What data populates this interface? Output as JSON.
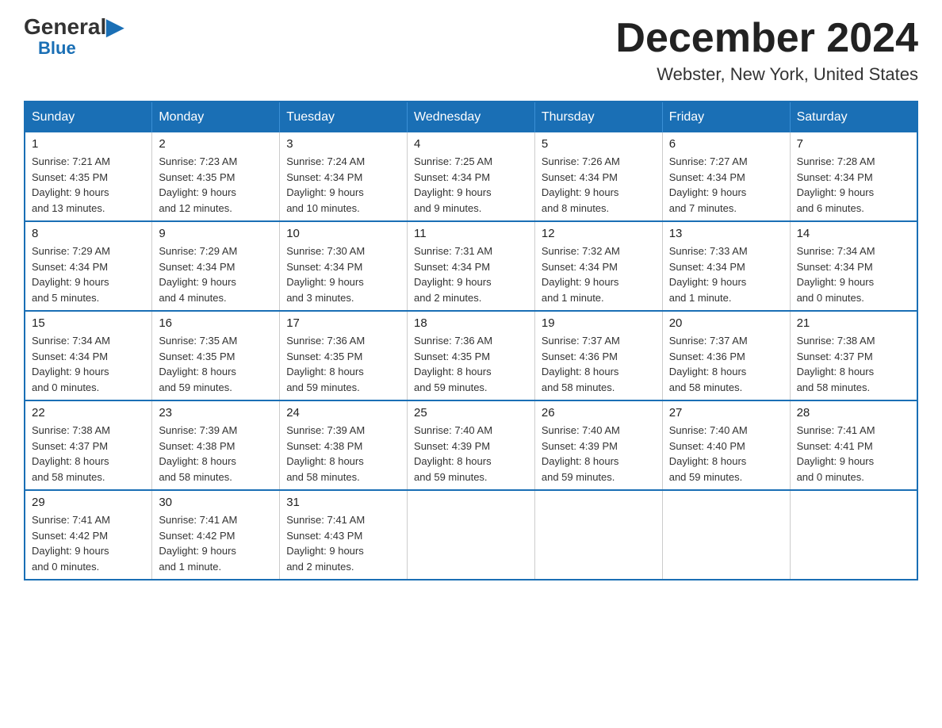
{
  "logo": {
    "general": "General",
    "blue": "Blue"
  },
  "title": "December 2024",
  "subtitle": "Webster, New York, United States",
  "days_of_week": [
    "Sunday",
    "Monday",
    "Tuesday",
    "Wednesday",
    "Thursday",
    "Friday",
    "Saturday"
  ],
  "weeks": [
    [
      {
        "day": "1",
        "info": "Sunrise: 7:21 AM\nSunset: 4:35 PM\nDaylight: 9 hours\nand 13 minutes."
      },
      {
        "day": "2",
        "info": "Sunrise: 7:23 AM\nSunset: 4:35 PM\nDaylight: 9 hours\nand 12 minutes."
      },
      {
        "day": "3",
        "info": "Sunrise: 7:24 AM\nSunset: 4:34 PM\nDaylight: 9 hours\nand 10 minutes."
      },
      {
        "day": "4",
        "info": "Sunrise: 7:25 AM\nSunset: 4:34 PM\nDaylight: 9 hours\nand 9 minutes."
      },
      {
        "day": "5",
        "info": "Sunrise: 7:26 AM\nSunset: 4:34 PM\nDaylight: 9 hours\nand 8 minutes."
      },
      {
        "day": "6",
        "info": "Sunrise: 7:27 AM\nSunset: 4:34 PM\nDaylight: 9 hours\nand 7 minutes."
      },
      {
        "day": "7",
        "info": "Sunrise: 7:28 AM\nSunset: 4:34 PM\nDaylight: 9 hours\nand 6 minutes."
      }
    ],
    [
      {
        "day": "8",
        "info": "Sunrise: 7:29 AM\nSunset: 4:34 PM\nDaylight: 9 hours\nand 5 minutes."
      },
      {
        "day": "9",
        "info": "Sunrise: 7:29 AM\nSunset: 4:34 PM\nDaylight: 9 hours\nand 4 minutes."
      },
      {
        "day": "10",
        "info": "Sunrise: 7:30 AM\nSunset: 4:34 PM\nDaylight: 9 hours\nand 3 minutes."
      },
      {
        "day": "11",
        "info": "Sunrise: 7:31 AM\nSunset: 4:34 PM\nDaylight: 9 hours\nand 2 minutes."
      },
      {
        "day": "12",
        "info": "Sunrise: 7:32 AM\nSunset: 4:34 PM\nDaylight: 9 hours\nand 1 minute."
      },
      {
        "day": "13",
        "info": "Sunrise: 7:33 AM\nSunset: 4:34 PM\nDaylight: 9 hours\nand 1 minute."
      },
      {
        "day": "14",
        "info": "Sunrise: 7:34 AM\nSunset: 4:34 PM\nDaylight: 9 hours\nand 0 minutes."
      }
    ],
    [
      {
        "day": "15",
        "info": "Sunrise: 7:34 AM\nSunset: 4:34 PM\nDaylight: 9 hours\nand 0 minutes."
      },
      {
        "day": "16",
        "info": "Sunrise: 7:35 AM\nSunset: 4:35 PM\nDaylight: 8 hours\nand 59 minutes."
      },
      {
        "day": "17",
        "info": "Sunrise: 7:36 AM\nSunset: 4:35 PM\nDaylight: 8 hours\nand 59 minutes."
      },
      {
        "day": "18",
        "info": "Sunrise: 7:36 AM\nSunset: 4:35 PM\nDaylight: 8 hours\nand 59 minutes."
      },
      {
        "day": "19",
        "info": "Sunrise: 7:37 AM\nSunset: 4:36 PM\nDaylight: 8 hours\nand 58 minutes."
      },
      {
        "day": "20",
        "info": "Sunrise: 7:37 AM\nSunset: 4:36 PM\nDaylight: 8 hours\nand 58 minutes."
      },
      {
        "day": "21",
        "info": "Sunrise: 7:38 AM\nSunset: 4:37 PM\nDaylight: 8 hours\nand 58 minutes."
      }
    ],
    [
      {
        "day": "22",
        "info": "Sunrise: 7:38 AM\nSunset: 4:37 PM\nDaylight: 8 hours\nand 58 minutes."
      },
      {
        "day": "23",
        "info": "Sunrise: 7:39 AM\nSunset: 4:38 PM\nDaylight: 8 hours\nand 58 minutes."
      },
      {
        "day": "24",
        "info": "Sunrise: 7:39 AM\nSunset: 4:38 PM\nDaylight: 8 hours\nand 58 minutes."
      },
      {
        "day": "25",
        "info": "Sunrise: 7:40 AM\nSunset: 4:39 PM\nDaylight: 8 hours\nand 59 minutes."
      },
      {
        "day": "26",
        "info": "Sunrise: 7:40 AM\nSunset: 4:39 PM\nDaylight: 8 hours\nand 59 minutes."
      },
      {
        "day": "27",
        "info": "Sunrise: 7:40 AM\nSunset: 4:40 PM\nDaylight: 8 hours\nand 59 minutes."
      },
      {
        "day": "28",
        "info": "Sunrise: 7:41 AM\nSunset: 4:41 PM\nDaylight: 9 hours\nand 0 minutes."
      }
    ],
    [
      {
        "day": "29",
        "info": "Sunrise: 7:41 AM\nSunset: 4:42 PM\nDaylight: 9 hours\nand 0 minutes."
      },
      {
        "day": "30",
        "info": "Sunrise: 7:41 AM\nSunset: 4:42 PM\nDaylight: 9 hours\nand 1 minute."
      },
      {
        "day": "31",
        "info": "Sunrise: 7:41 AM\nSunset: 4:43 PM\nDaylight: 9 hours\nand 2 minutes."
      },
      {
        "day": "",
        "info": ""
      },
      {
        "day": "",
        "info": ""
      },
      {
        "day": "",
        "info": ""
      },
      {
        "day": "",
        "info": ""
      }
    ]
  ]
}
